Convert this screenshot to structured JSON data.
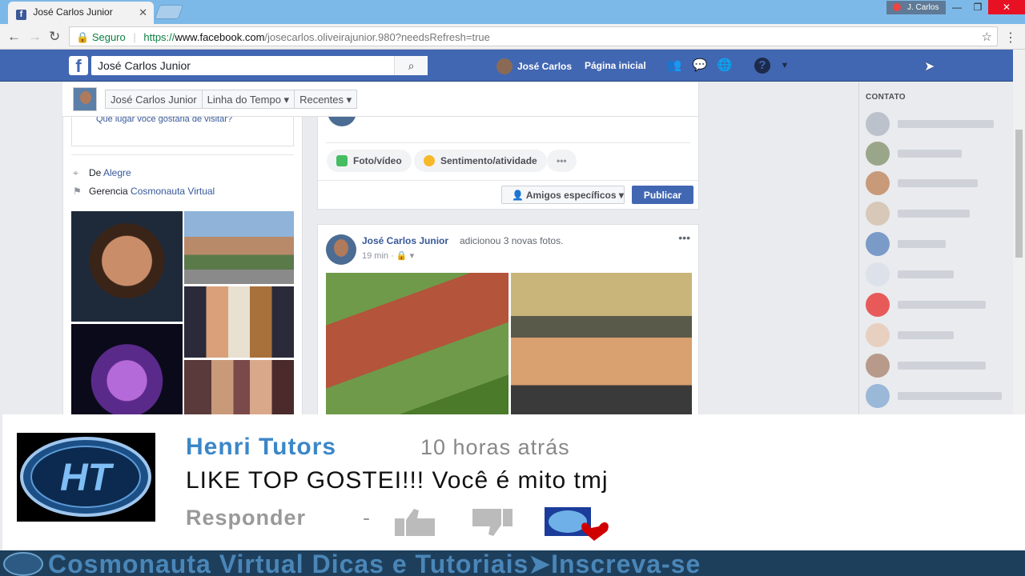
{
  "browser": {
    "tab_title": "José Carlos Junior",
    "profile_name": "J. Carlos",
    "secure_label": "Seguro",
    "url_scheme": "https://",
    "url_domain": "www.facebook.com",
    "url_path": "/josecarlos.oliveirajunior.980?needsRefresh=true"
  },
  "facebook": {
    "search_value": "José Carlos Junior",
    "user_name": "José Carlos",
    "home_label": "Página inicial"
  },
  "intro": {
    "prompt_text": "Que lugar você gostaria de visitar?",
    "from_label": "De",
    "from_value": "Alegre",
    "manages_label": "Gerencia",
    "manages_value": "Cosmonauta Virtual"
  },
  "timeline_nav": {
    "items": [
      "José Carlos Junior",
      "Linha do Tempo ▾",
      "Recentes ▾"
    ]
  },
  "composer": {
    "photo_label": "Foto/vídeo",
    "feeling_label": "Sentimento/atividade",
    "more_label": "•••",
    "audience_label": "Amigos específicos ▾",
    "publish_label": "Publicar"
  },
  "post": {
    "author": "José Carlos Junior",
    "action": "adicionou 3 novas fotos.",
    "time": "19 min ·",
    "privacy": "🔒 ▾",
    "more": "•••"
  },
  "contacts": {
    "header": "CONTATO"
  },
  "comment": {
    "author": "Henri Tutors",
    "time": "10 horas atrás",
    "text": "LIKE TOP GOSTEI!!! Você é mito tmj",
    "reply_label": "Responder",
    "separator": "-",
    "logo_text": "HT"
  },
  "banner": {
    "text": "Cosmonauta Virtual Dicas e Tutoriais➤Inscreva-se"
  },
  "colors": {
    "facebook_blue": "#4267b2",
    "link_blue": "#365899",
    "comment_name": "#3b87c8"
  }
}
